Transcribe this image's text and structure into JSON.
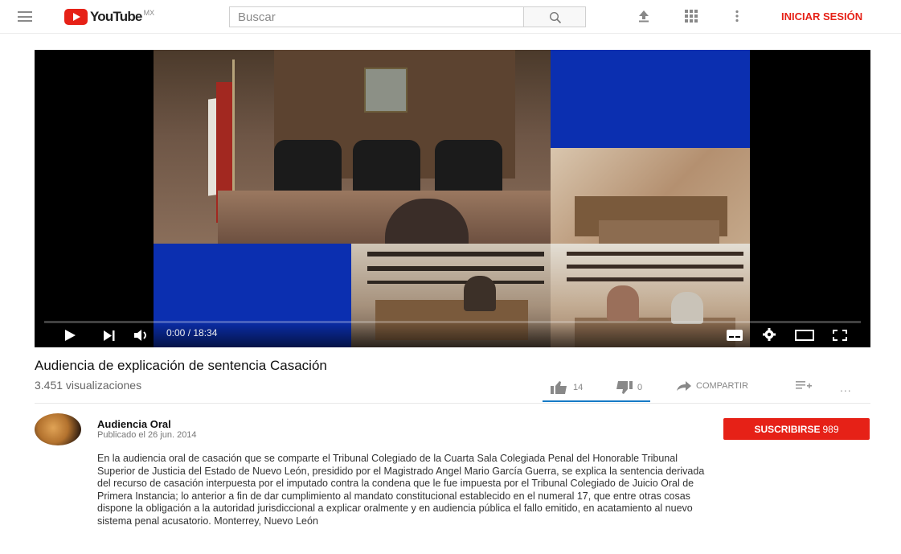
{
  "header": {
    "logo_text": "YouTube",
    "region": "MX",
    "search_placeholder": "Buscar",
    "signin_label": "INICIAR SESIÓN",
    "icons": [
      "menu-icon",
      "search-icon",
      "upload-icon",
      "apps-grid-icon",
      "more-vert-icon"
    ]
  },
  "player": {
    "time": "0:00 / 18:34",
    "progress": 0,
    "icons": [
      "play-icon",
      "next-icon",
      "volume-icon",
      "subtitles-icon",
      "settings-icon",
      "theater-icon",
      "fullscreen-icon"
    ]
  },
  "video": {
    "title": "Audiencia de explicación de sentencia Casación",
    "views": "3.451 visualizaciones",
    "likes": "14",
    "dislikes": "0",
    "share_label": "COMPARTIR",
    "more_label": "..."
  },
  "channel": {
    "name": "Audiencia Oral",
    "published": "Publicado el 26 jun. 2014",
    "subscribe_label": "SUSCRIBIRSE",
    "subscriber_count": "989"
  },
  "description": {
    "text": "En la audiencia oral de casación que se comparte el Tribunal Colegiado de la Cuarta Sala Colegiada Penal del Honorable Tribunal Superior de Justicia del Estado de Nuevo León, presidido por el Magistrado Angel Mario García Guerra, se explica la sentencia derivada del recurso de casación interpuesta por el imputado contra la condena que le fue impuesta por el Tribunal Colegiado de Juicio Oral de Primera Instancia; lo anterior a fin de dar cumplimiento al mandato constitucional establecido en el numeral 17, que entre otras cosas dispone la obligación a la autoridad jurisdiccional a explicar oralmente y en audiencia pública el fallo emitido, en acatamiento al nuevo sistema penal acusatorio. Monterrey, Nuevo León"
  },
  "colors": {
    "brand_red": "#e62117",
    "accent_blue": "#167ac6"
  }
}
